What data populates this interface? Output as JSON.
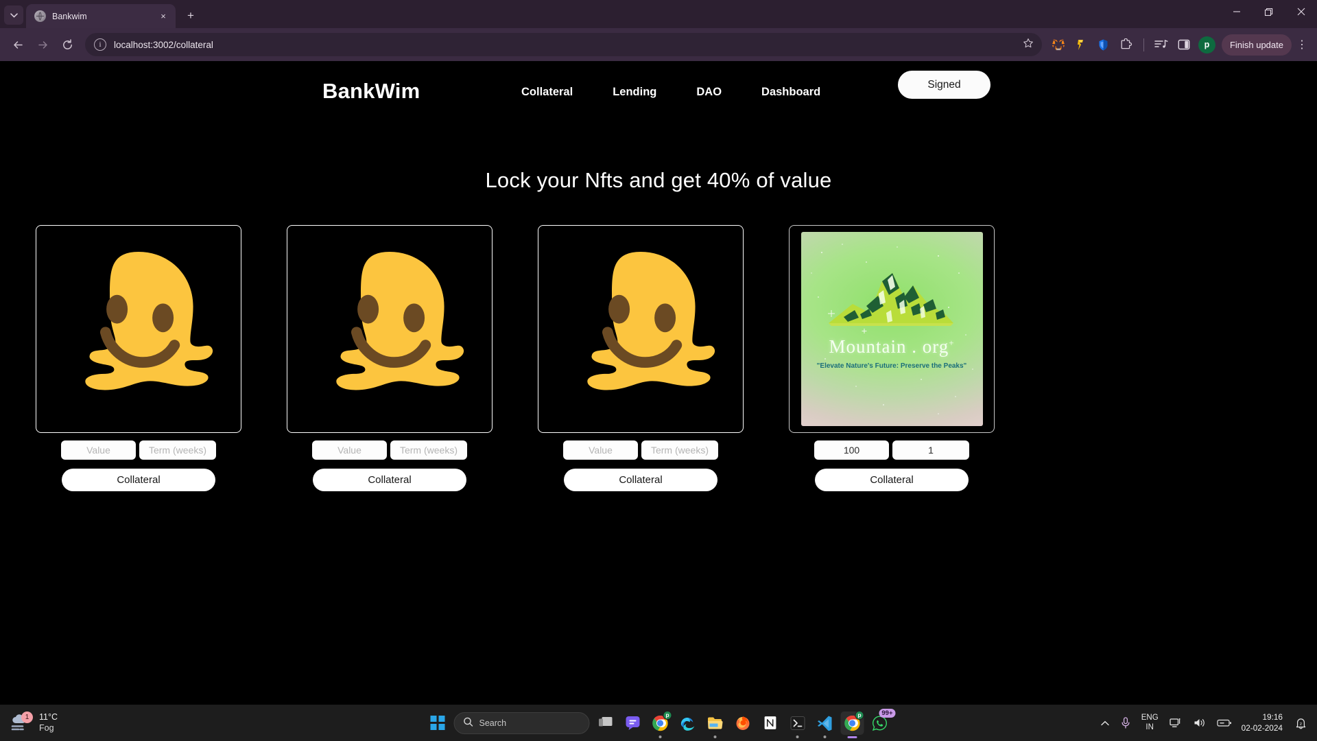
{
  "browser": {
    "tab": {
      "title": "Bankwim",
      "favicon_icon": "globe-icon",
      "close_icon": "×"
    },
    "tab_list_chevron_icon": "chevron-down-icon",
    "new_tab_icon": "+",
    "window_controls": {
      "minimize": "—",
      "maximize": "❐",
      "close": "✕"
    },
    "nav": {
      "back_icon": "←",
      "forward_icon": "→",
      "reload_icon": "⟳"
    },
    "omnibox": {
      "site_info_icon": "ⓘ",
      "url": "localhost:3002/collateral",
      "bookmark_icon": "☆"
    },
    "extensions": [
      {
        "name": "metamask-extension-icon"
      },
      {
        "name": "gold-token-extension-icon"
      },
      {
        "name": "blue-shield-extension-icon"
      },
      {
        "name": "extensions-puzzle-icon"
      },
      {
        "name": "reading-list-icon"
      },
      {
        "name": "side-panel-icon"
      }
    ],
    "profile": {
      "initial": "p"
    },
    "update_button": "Finish update",
    "menu_icon": "⋮"
  },
  "site": {
    "brand": "BankWim",
    "nav_links": [
      "Collateral",
      "Lending",
      "DAO",
      "Dashboard"
    ],
    "signed_button": "Signed",
    "headline": "Lock your Nfts and get 40% of value",
    "cards": [
      {
        "art": "melting-face-emoji",
        "value": "",
        "value_placeholder": "Value",
        "term": "",
        "term_placeholder": "Term (weeks)",
        "button": "Collateral"
      },
      {
        "art": "melting-face-emoji",
        "value": "",
        "value_placeholder": "Value",
        "term": "",
        "term_placeholder": "Term (weeks)",
        "button": "Collateral"
      },
      {
        "art": "melting-face-emoji",
        "value": "",
        "value_placeholder": "Value",
        "term": "",
        "term_placeholder": "Term (weeks)",
        "button": "Collateral"
      },
      {
        "art": "mountain-nft-image",
        "art_title": "Mountain . org",
        "art_title_sup": "+",
        "art_tagline": "\"Elevate Nature's Future: Preserve the Peaks\"",
        "value": "100",
        "value_placeholder": "Value",
        "term": "1",
        "term_placeholder": "Term (weeks)",
        "button": "Collateral"
      }
    ]
  },
  "taskbar": {
    "weather": {
      "badge": "1",
      "temp": "11°C",
      "condition": "Fog",
      "icon": "fog-cloud-icon"
    },
    "start_icon": "windows-start-icon",
    "search": {
      "icon": "search-icon",
      "placeholder": "Search"
    },
    "apps": [
      {
        "name": "task-view-icon",
        "badge": ""
      },
      {
        "name": "teams-chat-icon",
        "badge": ""
      },
      {
        "name": "chrome-icon",
        "badge": "p"
      },
      {
        "name": "edge-icon",
        "badge": ""
      },
      {
        "name": "file-explorer-icon",
        "badge": ""
      },
      {
        "name": "firefox-icon",
        "badge": ""
      },
      {
        "name": "notion-icon",
        "badge": ""
      },
      {
        "name": "terminal-icon",
        "badge": ""
      },
      {
        "name": "vscode-icon",
        "badge": ""
      },
      {
        "name": "chrome-active-icon",
        "badge": "p"
      },
      {
        "name": "whatsapp-icon",
        "badge": "99+"
      }
    ],
    "tray": {
      "overflow_icon": "⌃",
      "mic_icon": "microphone-icon",
      "language": "ENG",
      "region": "IN",
      "network_icon": "network-icon",
      "volume_icon": "volume-icon",
      "battery_icon": "battery-icon",
      "time": "19:16",
      "date": "02-02-2024",
      "notification_icon": "bell-dnd-icon"
    }
  },
  "colors": {
    "chrome_tabstrip": "#2c1f30",
    "chrome_toolbar": "#3b2b42",
    "page_background": "#000000",
    "accent_white": "#ffffff",
    "emoji_yellow": "#fcc53f",
    "emoji_brown": "#6b4a23"
  }
}
